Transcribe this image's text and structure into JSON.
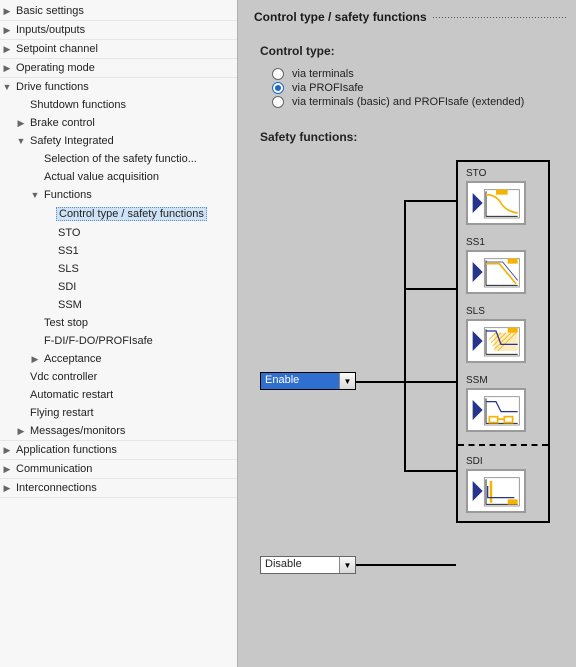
{
  "tree": {
    "basic_settings": "Basic settings",
    "inputs_outputs": "Inputs/outputs",
    "setpoint_channel": "Setpoint channel",
    "operating_mode": "Operating mode",
    "drive_functions": "Drive functions",
    "shutdown_functions": "Shutdown functions",
    "brake_control": "Brake control",
    "safety_integrated": "Safety Integrated",
    "selection_safety": "Selection of the safety functio...",
    "actual_value": "Actual value acquisition",
    "functions": "Functions",
    "ctrl_safety": "Control type / safety functions",
    "sto": "STO",
    "ss1": "SS1",
    "sls": "SLS",
    "sdi": "SDI",
    "ssm": "SSM",
    "test_stop": "Test stop",
    "fdi_fdo": "F-DI/F-DO/PROFIsafe",
    "acceptance": "Acceptance",
    "vdc": "Vdc controller",
    "auto_restart": "Automatic restart",
    "flying_restart": "Flying restart",
    "msgs_monitors": "Messages/monitors",
    "app_functions": "Application functions",
    "communication": "Communication",
    "interconnections": "Interconnections"
  },
  "content": {
    "title": "Control type / safety functions",
    "control_type_label": "Control type:",
    "radio_terminals": "via terminals",
    "radio_profisafe": "via PROFIsafe",
    "radio_both": "via terminals (basic) and PROFIsafe (extended)",
    "safety_label": "Safety functions:",
    "enable": "Enable",
    "disable": "Disable",
    "func_sto": "STO",
    "func_ss1": "SS1",
    "func_sls": "SLS",
    "func_ssm": "SSM",
    "func_sdi": "SDI"
  }
}
